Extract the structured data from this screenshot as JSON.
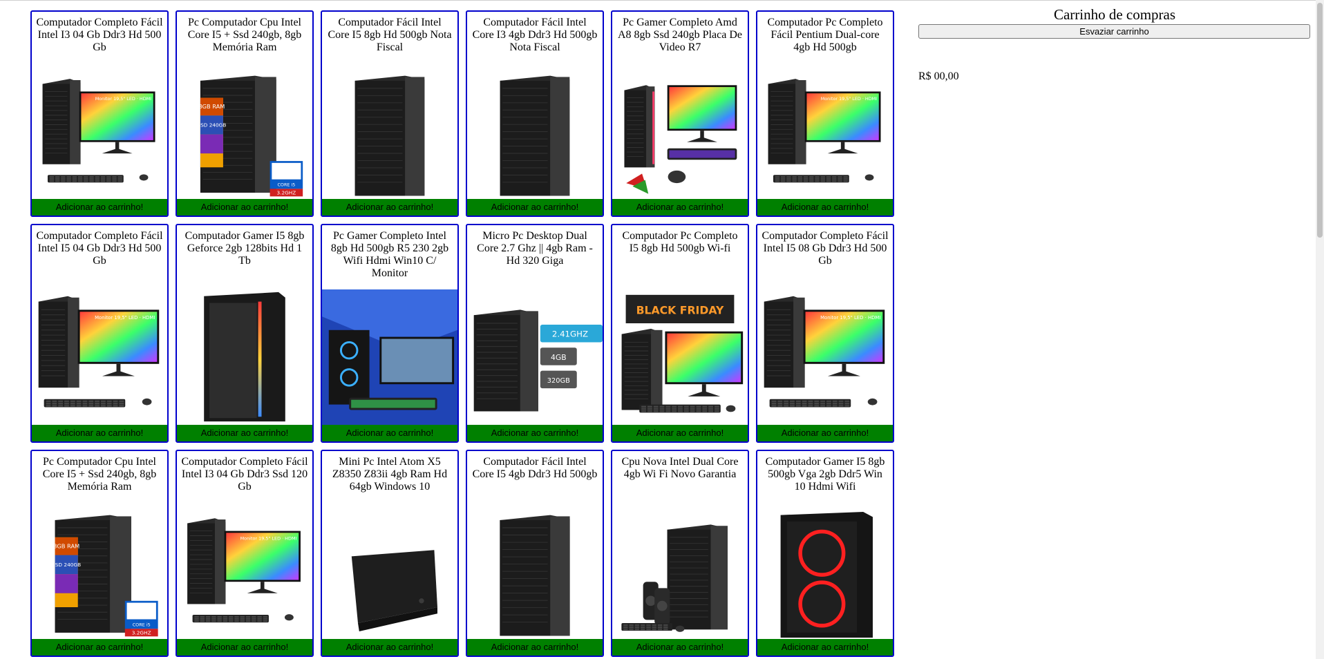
{
  "cart": {
    "title": "Carrinho de compras",
    "empty_button": "Esvaziar carrinho",
    "total": "R$ 00,00"
  },
  "add_button_label": "Adicionar ao carrinho!",
  "products": [
    {
      "name": "Computador Completo Fácil Intel I3 04 Gb Ddr3 Hd 500 Gb",
      "image": "desktop-with-monitor"
    },
    {
      "name": "Pc Computador Cpu Intel Core I5 + Ssd 240gb, 8gb Memória Ram",
      "image": "tower-with-spec-label"
    },
    {
      "name": "Computador Fácil Intel Core I5 8gb Hd 500gb Nota Fiscal",
      "image": "tower"
    },
    {
      "name": "Computador Fácil Intel Core I3 4gb Ddr3 Hd 500gb Nota Fiscal",
      "image": "tower"
    },
    {
      "name": "Pc Gamer Completo Amd A8 8gb Ssd 240gb Placa De Video R7",
      "image": "gamer-setup"
    },
    {
      "name": "Computador Pc Completo Fácil Pentium Dual-core 4gb Hd 500gb",
      "image": "desktop-with-monitor"
    },
    {
      "name": "Computador Completo Fácil Intel I5 04 Gb Ddr3 Hd 500 Gb",
      "image": "desktop-with-monitor"
    },
    {
      "name": "Computador Gamer I5 8gb Geforce 2gb 128bits Hd 1 Tb",
      "image": "gamer-tower-led"
    },
    {
      "name": "Pc Gamer Completo Intel 8gb Hd 500gb R5 230 2gb Wifi Hdmi Win10 C/ Monitor",
      "image": "gamer-setup-blue"
    },
    {
      "name": "Micro Pc Desktop Dual Core 2.7 Ghz || 4gb Ram - Hd 320 Giga",
      "image": "tower-with-specs"
    },
    {
      "name": "Computador Pc Completo I5 8gb Hd 500gb Wi-fi",
      "image": "black-friday-setup"
    },
    {
      "name": "Computador Completo Fácil Intel I5 08 Gb Ddr3 Hd 500 Gb",
      "image": "desktop-with-monitor"
    },
    {
      "name": "Pc Computador Cpu Intel Core I5 + Ssd 240gb, 8gb Memória Ram",
      "image": "tower-with-spec-label"
    },
    {
      "name": "Computador Completo Fácil Intel I3 04 Gb Ddr3 Ssd 120 Gb",
      "image": "desktop-with-monitor"
    },
    {
      "name": "Mini Pc Intel Atom X5 Z8350 Z83ii 4gb Ram Hd 64gb Windows 10",
      "image": "mini-pc"
    },
    {
      "name": "Computador Fácil Intel Core I5 4gb Ddr3 Hd 500gb",
      "image": "tower"
    },
    {
      "name": "Cpu Nova Intel Dual Core 4gb Wi Fi Novo Garantia",
      "image": "tower-with-speakers"
    },
    {
      "name": "Computador Gamer I5 8gb 500gb Vga 2gb Ddr5 Win 10 Hdmi Wifi",
      "image": "gamer-tower-red-rings"
    }
  ],
  "image_texts": {
    "monitor": "Monitor 19,5\" LED · HDMI",
    "spec_ram": "8GB RAM",
    "spec_ssd": "SSD 240GB",
    "intel_badge": "CORE i5",
    "intel_clock": "3.2GHZ",
    "proc": "2.41GHZ",
    "mem": "4GB",
    "hd": "320GB",
    "black_friday": "BLACK FRIDAY"
  },
  "colors": {
    "card_border": "#0000cc",
    "add_button": "#008000"
  }
}
